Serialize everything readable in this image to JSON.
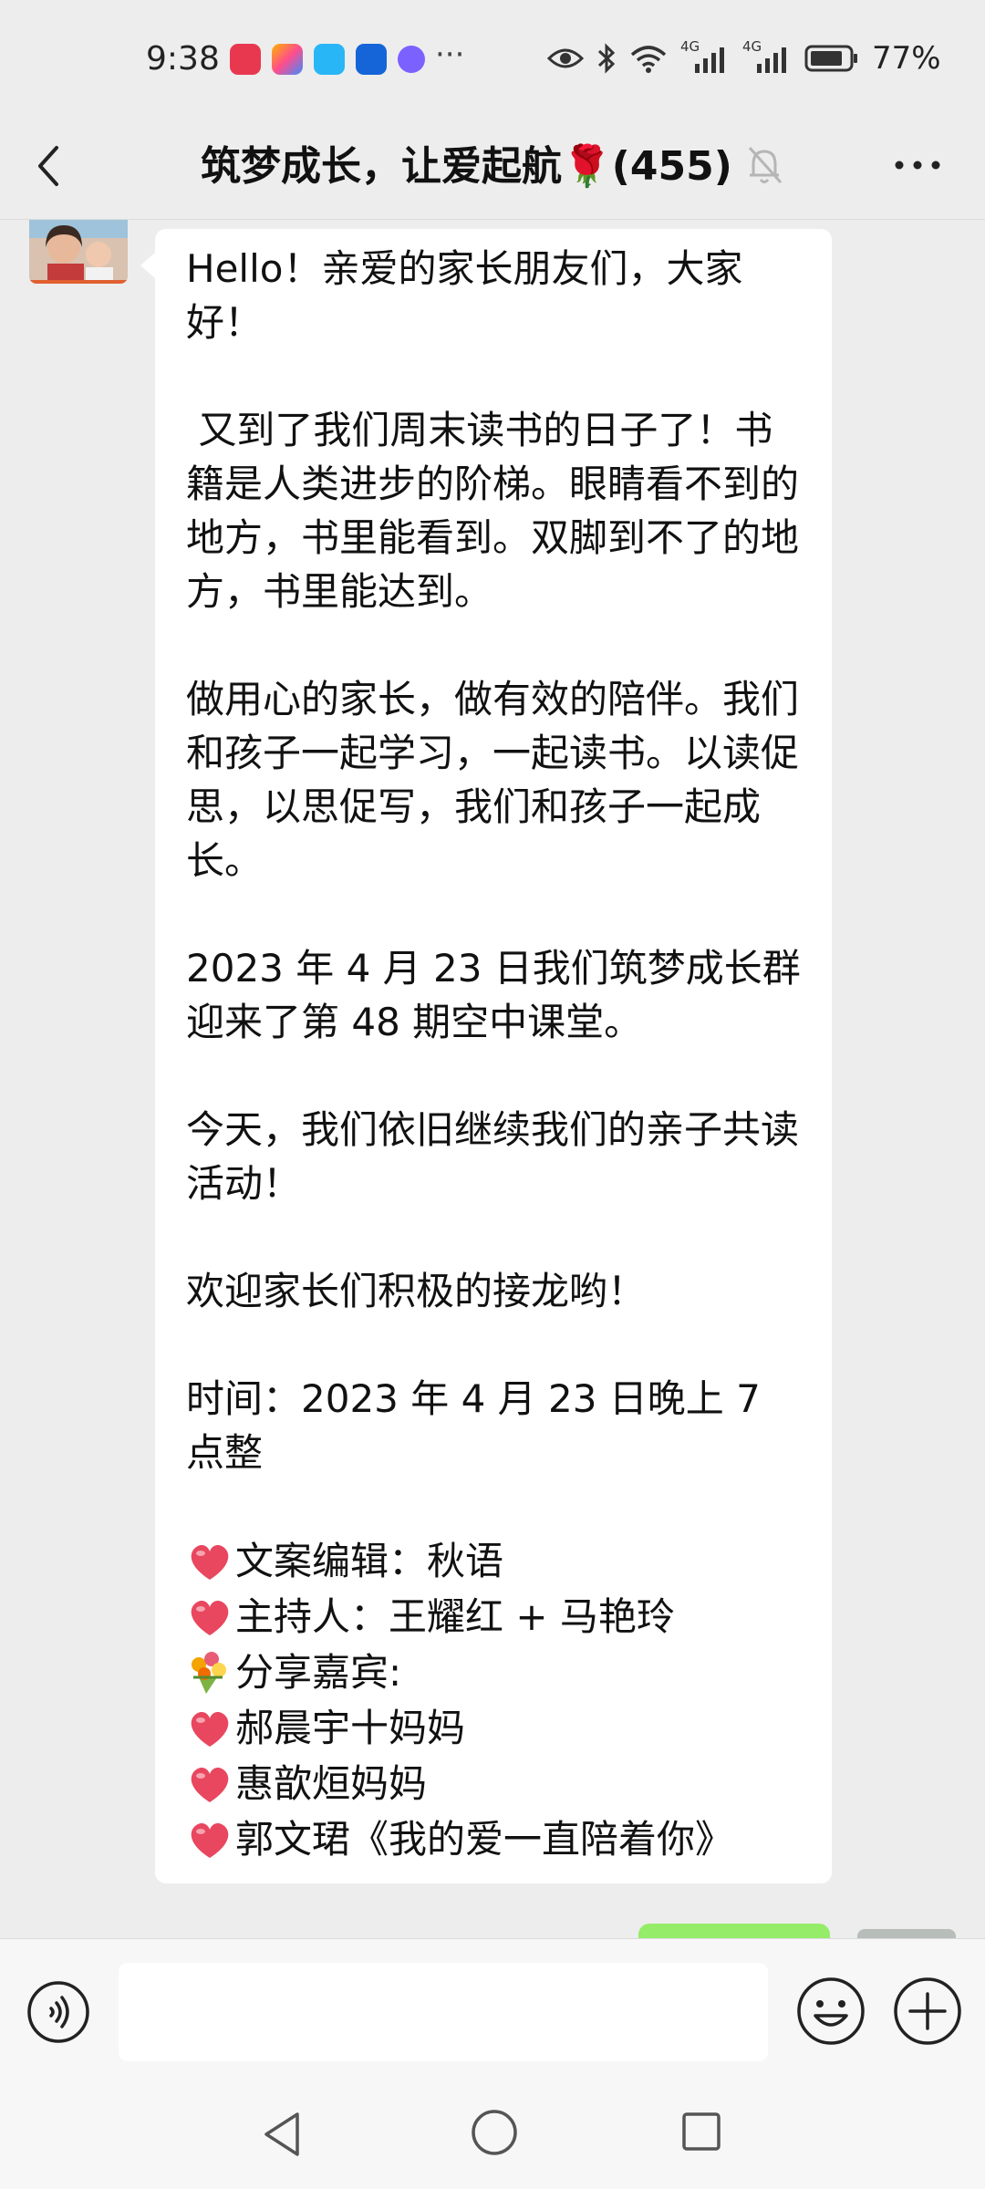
{
  "status_bar": {
    "time": "9:38",
    "more": "···",
    "network_1": "4G",
    "network_2": "4G",
    "battery": "77%"
  },
  "header": {
    "title": "筑梦成长，让爱起航🌹(455)"
  },
  "message": {
    "paragraphs": [
      "Hello！亲爱的家长朋友们，大家好！",
      " 又到了我们周末读书的日子了！书籍是人类进步的阶梯。眼睛看不到的地方，书里能看到。双脚到不了的地方，书里能达到。",
      "做用心的家长，做有效的陪伴。我们和孩子一起学习，一起读书。以读促思，以思促写，我们和孩子一起成长。",
      "2023 年 4 月 23 日我们筑梦成长群迎来了第 48 期空中课堂。",
      "今天，我们依旧继续我们的亲子共读活动！",
      "欢迎家长们积极的接龙哟！",
      "时间：2023 年 4 月 23 日晚上 7 点整"
    ],
    "credits": [
      "文案编辑：秋语",
      "主持人：王耀红 + 马艳玲",
      "分享嘉宾:",
      "郝晨宇十妈妈",
      "惠歆烜妈妈",
      "郭文珺《我的爱一直陪着你》"
    ]
  },
  "colors": {
    "background": "#ededed",
    "bubble": "#ffffff",
    "self_bubble": "#95ec69",
    "heart": "#e8475f"
  }
}
